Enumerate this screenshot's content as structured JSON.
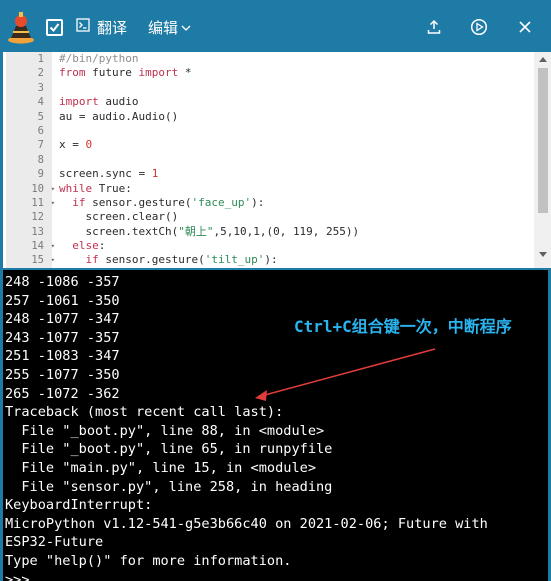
{
  "toolbar": {
    "translate_label": "翻译",
    "edit_label": "编辑",
    "accent_color": "#1e7ba5",
    "icons": [
      "app-logo-icon",
      "checkbox-checked-icon",
      "terminal-icon",
      "chevron-down-icon",
      "upload-icon",
      "run-icon",
      "close-icon"
    ]
  },
  "editor": {
    "lines": [
      {
        "n": "1",
        "fold": "",
        "parts": [
          {
            "t": "#/bin/python",
            "c": "c-comment"
          }
        ]
      },
      {
        "n": "2",
        "fold": "",
        "parts": [
          {
            "t": "from",
            "c": "c-kw"
          },
          {
            "t": " future ",
            "c": ""
          },
          {
            "t": "import",
            "c": "c-kw"
          },
          {
            "t": " *",
            "c": ""
          }
        ]
      },
      {
        "n": "3",
        "fold": "",
        "parts": []
      },
      {
        "n": "4",
        "fold": "",
        "parts": [
          {
            "t": "import",
            "c": "c-kw"
          },
          {
            "t": " audio",
            "c": ""
          }
        ]
      },
      {
        "n": "5",
        "fold": "",
        "parts": [
          {
            "t": "au = audio.Audio()",
            "c": ""
          }
        ]
      },
      {
        "n": "6",
        "fold": "",
        "parts": []
      },
      {
        "n": "7",
        "fold": "",
        "parts": [
          {
            "t": "x = ",
            "c": ""
          },
          {
            "t": "0",
            "c": "c-num"
          }
        ]
      },
      {
        "n": "8",
        "fold": "",
        "parts": []
      },
      {
        "n": "9",
        "fold": "",
        "parts": [
          {
            "t": "screen.sync = ",
            "c": ""
          },
          {
            "t": "1",
            "c": "c-num"
          }
        ]
      },
      {
        "n": "10",
        "fold": "▾",
        "parts": [
          {
            "t": "while",
            "c": "c-kw"
          },
          {
            "t": " True:",
            "c": ""
          }
        ]
      },
      {
        "n": "11",
        "fold": "▾",
        "parts": [
          {
            "t": "  if",
            "c": "c-kw"
          },
          {
            "t": " sensor.gesture(",
            "c": ""
          },
          {
            "t": "'face_up'",
            "c": "c-str"
          },
          {
            "t": "):",
            "c": ""
          }
        ]
      },
      {
        "n": "12",
        "fold": "",
        "parts": [
          {
            "t": "    screen.clear()",
            "c": ""
          }
        ]
      },
      {
        "n": "13",
        "fold": "",
        "parts": [
          {
            "t": "    screen.textCh(",
            "c": ""
          },
          {
            "t": "\"朝上\"",
            "c": "c-str"
          },
          {
            "t": ",5,10,1,(0, 119, 255))",
            "c": ""
          }
        ]
      },
      {
        "n": "14",
        "fold": "▾",
        "parts": [
          {
            "t": "  else",
            "c": "c-kw"
          },
          {
            "t": ":",
            "c": ""
          }
        ]
      },
      {
        "n": "15",
        "fold": "▾",
        "parts": [
          {
            "t": "    if",
            "c": "c-kw"
          },
          {
            "t": " sensor.gesture(",
            "c": ""
          },
          {
            "t": "'tilt_up'",
            "c": "c-str"
          },
          {
            "t": "):",
            "c": ""
          }
        ]
      }
    ]
  },
  "terminal": {
    "lines": [
      "248 -1086 -357",
      "257 -1061 -350",
      "248 -1077 -347",
      "243 -1077 -357",
      "251 -1083 -347",
      "255 -1077 -350",
      "265 -1072 -362",
      "Traceback (most recent call last):",
      "  File \"_boot.py\", line 88, in <module>",
      "  File \"_boot.py\", line 65, in runpyfile",
      "  File \"main.py\", line 15, in <module>",
      "  File \"sensor.py\", line 258, in heading",
      "KeyboardInterrupt:",
      "MicroPython v1.12-541-g5e3b66c40 on 2021-02-06; Future with",
      "ESP32-Future",
      "Type \"help()\" for more information.",
      ">>> "
    ],
    "annotation": "Ctrl+C组合键一次，中断程序",
    "annotation_color": "#2ab4f0",
    "arrow_color": "#e03c3c"
  }
}
